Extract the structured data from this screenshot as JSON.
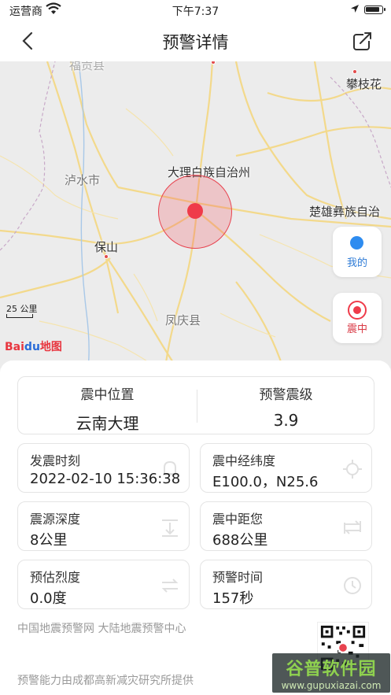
{
  "status": {
    "carrier": "运营商",
    "time": "下午7:37"
  },
  "nav": {
    "title": "预警详情"
  },
  "map": {
    "labels": {
      "panzhihua": "攀枝花",
      "dali": "大理白族自治州",
      "lushui": "泸水市",
      "chuxiong": "楚雄彝族自治",
      "baoshan": "保山",
      "fengqing": "凤庆县",
      "top_partial": "福贡县"
    },
    "scale": "25 公里",
    "logo_a": "Bai",
    "logo_b": "du",
    "logo_c": "地图",
    "btn_mine": "我的",
    "btn_epicenter": "震中"
  },
  "summary": {
    "location_label": "震中位置",
    "location_value": "云南大理",
    "magnitude_label": "预警震级",
    "magnitude_value": "3.9"
  },
  "details": [
    {
      "label": "发震时刻",
      "value": "2022-02-10 15:36:38",
      "icon": "bell-icon"
    },
    {
      "label": "震中经纬度",
      "value": "E100.0，N25.6",
      "icon": "crosshair-icon"
    },
    {
      "label": "震源深度",
      "value": "8公里",
      "icon": "depth-icon"
    },
    {
      "label": "震中距您",
      "value": "688公里",
      "icon": "distance-icon"
    },
    {
      "label": "预估烈度",
      "value": "0.0度",
      "icon": "intensity-icon"
    },
    {
      "label": "预警时间",
      "value": "157秒",
      "icon": "clock-icon"
    }
  ],
  "footer": {
    "source": "中国地震预警网 大陆地震预警中心",
    "provider": "预警能力由成都高新减灾研究所提供"
  },
  "watermark": {
    "title": "谷普软件园",
    "url": "www.gupuxiazai.com"
  }
}
